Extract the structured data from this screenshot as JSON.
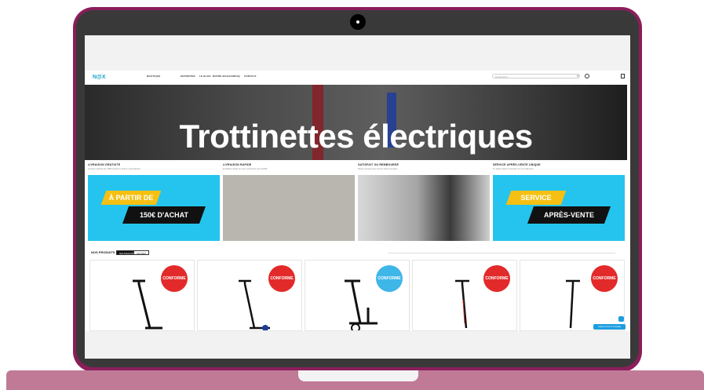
{
  "nav": {
    "logo": "N@X",
    "items": [
      "BOUTIQUE",
      "ENTRETIEN",
      "LE BLOG",
      "NOTRE MAGASIN",
      "FAQ",
      "CONTACT"
    ],
    "search_placeholder": "Rechercher..."
  },
  "hero": {
    "title": "Trottinettes électriques"
  },
  "features": [
    {
      "title": "LIVRAISON GRATUITE",
      "sub": "Livraison gratuite dès 150€ d'achat en France métropolitaine",
      "tag_top": "À PARTIR DE",
      "tag_bottom": "150€ D'ACHAT"
    },
    {
      "title": "LIVRAISON RAPIDE",
      "sub": "Expédition rapide de votre commande sous 24/48h"
    },
    {
      "title": "SATISFAIT OU REMBOURSÉ",
      "sub": "Retour accepté sous 14 jours après réception"
    },
    {
      "title": "SERVICE APRÈS-VENTE UNIQUE",
      "sub": "Un atelier dédié à l'entretien de vos trottinettes",
      "tag_top": "SERVICE",
      "tag_bottom": "APRÈS-VENTE"
    }
  ],
  "products": {
    "section_title": "NOS PRODUITS",
    "tabs": [
      "NOUVEAUTÉS",
      "SOLDES"
    ],
    "badge": "CONFORME"
  },
  "chat": {
    "label": "Laissez-nous un message"
  },
  "colors": {
    "accent": "#25c4ee",
    "brand": "#16a3c9",
    "badge_red": "#e32a2a",
    "badge_blue": "#3fb6e8"
  }
}
